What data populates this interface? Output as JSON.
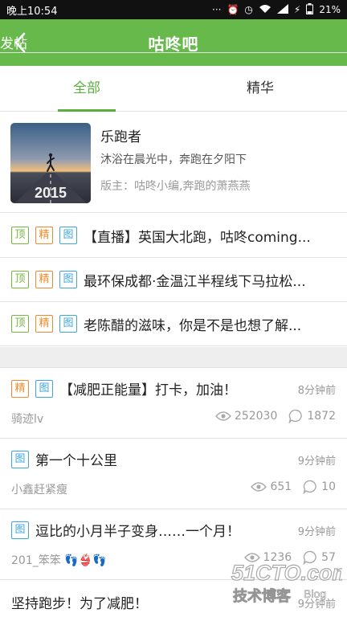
{
  "status_bar": {
    "time": "晚上10:54",
    "battery": "21%"
  },
  "header": {
    "title": "咕咚吧",
    "post_label": "发帖"
  },
  "tabs": [
    {
      "label": "全部"
    },
    {
      "label": "精华"
    }
  ],
  "forum": {
    "name": "乐跑者",
    "slogan": "沐浴在晨光中，奔跑在夕阳下",
    "moderators": "版主：咕咚小编,奔跑的萧燕燕",
    "cover_text": "2015"
  },
  "pinned_posts": [
    {
      "tags": [
        "顶",
        "精",
        "图"
      ],
      "title": "【直播】英国大北跑，咕咚coming..."
    },
    {
      "tags": [
        "顶",
        "精",
        "图"
      ],
      "title": "最环保成都·金温江半程线下马拉松..."
    },
    {
      "tags": [
        "顶",
        "精",
        "图"
      ],
      "title": "老陈醋的滋味，你是不是也想了解..."
    }
  ],
  "posts": [
    {
      "tags": [
        "精",
        "图"
      ],
      "title": "【减肥正能量】打卡，加油！",
      "time": "8分钟前",
      "author": "骑迹lv",
      "views": "252030",
      "comments": "1872"
    },
    {
      "tags": [
        "图"
      ],
      "title": "第一个十公里",
      "time": "9分钟前",
      "author": "小鑫赶紧瘦",
      "views": "651",
      "comments": "10"
    },
    {
      "tags": [
        "图"
      ],
      "title": "逗比的小月半子变身……一个月！",
      "time": "9分钟前",
      "author": "201_笨笨 👣👙👣",
      "views": "1236",
      "comments": "57"
    },
    {
      "tags": [],
      "title": "坚持跑步！为了减肥！",
      "time": "9分钟前"
    }
  ],
  "watermark": {
    "site": "51CTO.com",
    "sub": "技术博客",
    "blog": "Blog"
  },
  "colors": {
    "accent": "#66b94a",
    "tag_top": "#74b83f",
    "tag_essence": "#ef8a2a",
    "tag_image": "#3ea6d9"
  }
}
